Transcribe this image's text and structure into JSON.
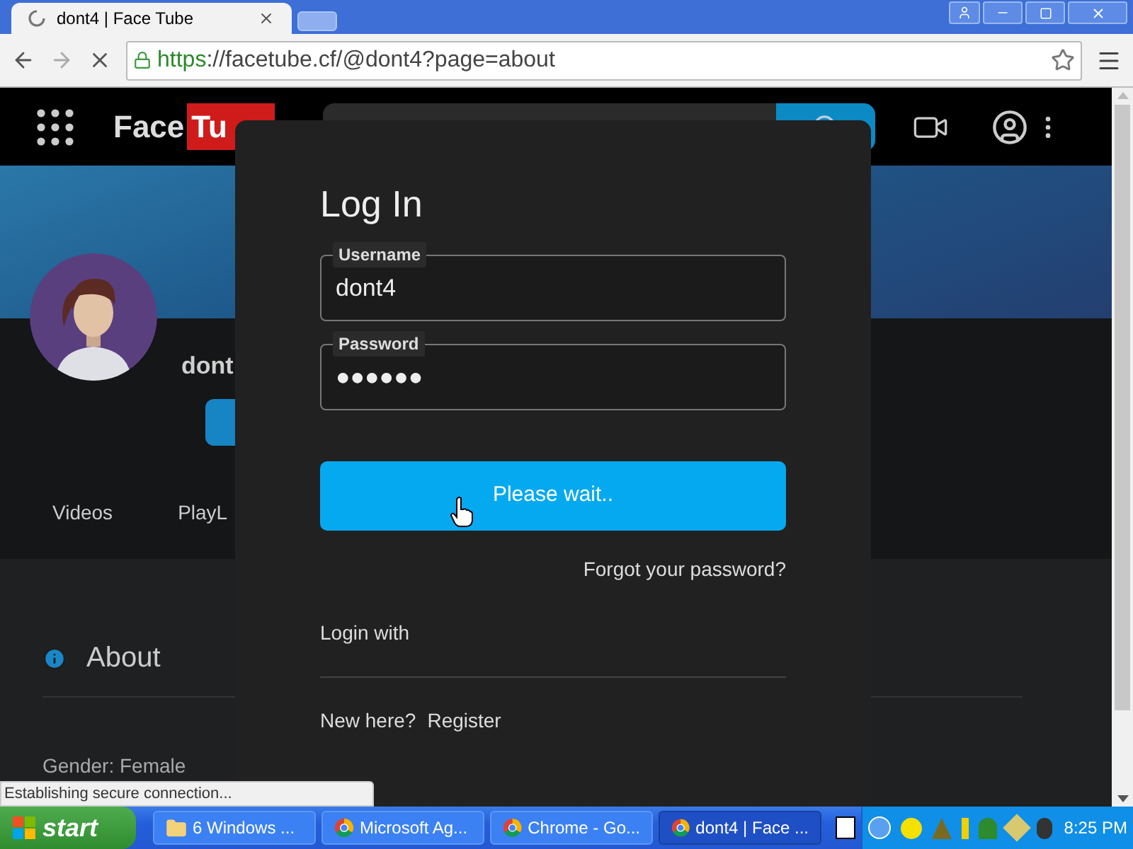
{
  "browser": {
    "tabs": [
      {
        "title": "dont4 | Face Tube",
        "selected": true,
        "loading": true
      }
    ],
    "url": {
      "scheme": "https",
      "rest": "://facetube.cf/@dont4?page=about"
    },
    "loading": true
  },
  "site": {
    "logo": {
      "first": "Face",
      "second": "Tu"
    },
    "profile_name": "dont",
    "nav": [
      "Videos",
      "PlayL"
    ],
    "about": {
      "title": "About",
      "gender": "Gender: Female"
    }
  },
  "login": {
    "title": "Log In",
    "fields": [
      {
        "label": "Username",
        "value": "dont4"
      },
      {
        "label": "Password",
        "value": "●●●●●●"
      }
    ],
    "submit": "Please wait..",
    "forgot": "Forgot your password?",
    "login_with": "Login with",
    "new_here": "New here?",
    "register": "Register"
  },
  "status": "Establishing secure connection...",
  "taskbar": {
    "start": "start",
    "items": [
      {
        "label": "6 Windows ...",
        "kind": "folder",
        "selected": false
      },
      {
        "label": "Microsoft Ag...",
        "kind": "chrome",
        "selected": false
      },
      {
        "label": "Chrome - Go...",
        "kind": "chrome",
        "selected": false
      },
      {
        "label": "dont4 | Face ...",
        "kind": "chrome",
        "selected": true
      }
    ],
    "clock": "8:25 PM"
  }
}
